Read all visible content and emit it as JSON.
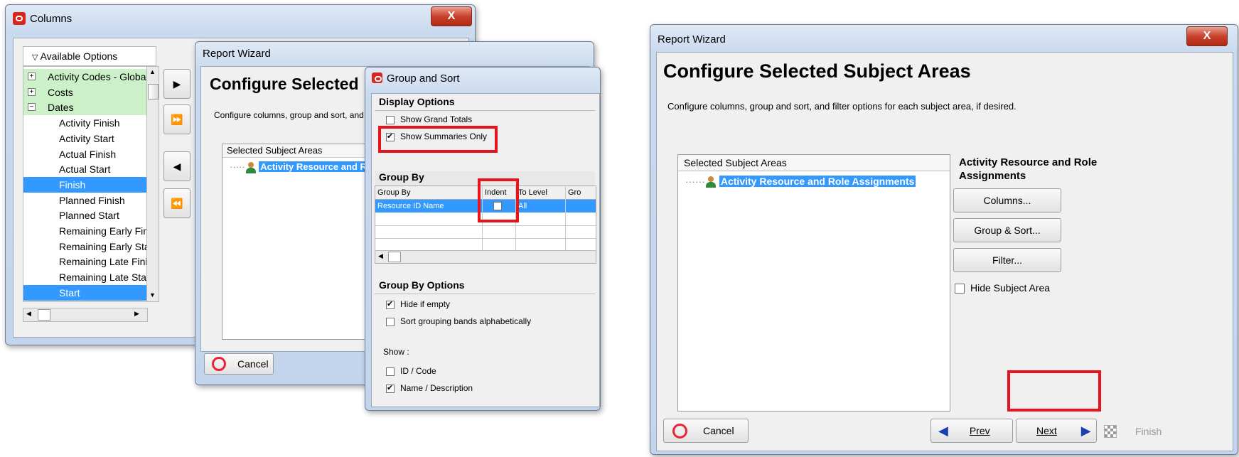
{
  "columns_window": {
    "title": "Columns",
    "close": "X",
    "tree_header": "Available Options",
    "items": [
      {
        "label": "Activity Codes - Global",
        "kind": "group",
        "expander": "+"
      },
      {
        "label": "Costs",
        "kind": "group",
        "expander": "+"
      },
      {
        "label": "Dates",
        "kind": "group",
        "expander": "−"
      },
      {
        "label": "Activity Finish",
        "kind": "child"
      },
      {
        "label": "Activity Start",
        "kind": "child"
      },
      {
        "label": "Actual Finish",
        "kind": "child"
      },
      {
        "label": "Actual Start",
        "kind": "child"
      },
      {
        "label": "Finish",
        "kind": "child",
        "selected": true
      },
      {
        "label": "Planned Finish",
        "kind": "child"
      },
      {
        "label": "Planned Start",
        "kind": "child"
      },
      {
        "label": "Remaining Early Finis",
        "kind": "child"
      },
      {
        "label": "Remaining Early Star",
        "kind": "child"
      },
      {
        "label": "Remaining Late Finisl",
        "kind": "child"
      },
      {
        "label": "Remaining Late Start",
        "kind": "child"
      },
      {
        "label": "Start",
        "kind": "child",
        "selected": true
      }
    ],
    "move_buttons": [
      "▶",
      "⏩",
      "◀",
      "⏪"
    ]
  },
  "wizard_back": {
    "title": "Report Wizard",
    "heading": "Configure Selected",
    "description": "Configure columns, group and sort, and",
    "list_header": "Selected Subject Areas",
    "list_item": "Activity Resource and Role",
    "cancel": "Cancel"
  },
  "group_sort": {
    "title": "Group and Sort",
    "display_options": "Display Options",
    "show_grand_totals": "Show Grand Totals",
    "show_summaries_only": "Show Summaries Only",
    "group_by_header": "Group By",
    "columns": [
      "Group By",
      "Indent",
      "To Level",
      "Gro"
    ],
    "row": {
      "group_by": "Resource ID Name",
      "to_level": "All"
    },
    "group_by_options": "Group By Options",
    "hide_if_empty": "Hide if empty",
    "sort_alpha": "Sort grouping bands alphabetically",
    "show_label": "Show :",
    "id_code": "ID / Code",
    "name_desc": "Name / Description"
  },
  "wizard_front": {
    "title": "Report Wizard",
    "close": "X",
    "heading": "Configure Selected Subject Areas",
    "description": "Configure columns, group and sort, and filter options for each subject area, if desired.",
    "list_header": "Selected Subject Areas",
    "list_item": "Activity Resource and Role Assignments",
    "panel_title": "Activity Resource and Role Assignments",
    "columns_btn": "Columns...",
    "group_sort_btn": "Group & Sort...",
    "filter_btn": "Filter...",
    "hide_subject_area": "Hide Subject Area",
    "cancel": "Cancel",
    "prev": "Prev",
    "next": "Next",
    "finish": "Finish"
  },
  "colors": {
    "highlight": "#e8141c",
    "selection": "#3399ff",
    "group_bg": "#ccf0c8"
  }
}
